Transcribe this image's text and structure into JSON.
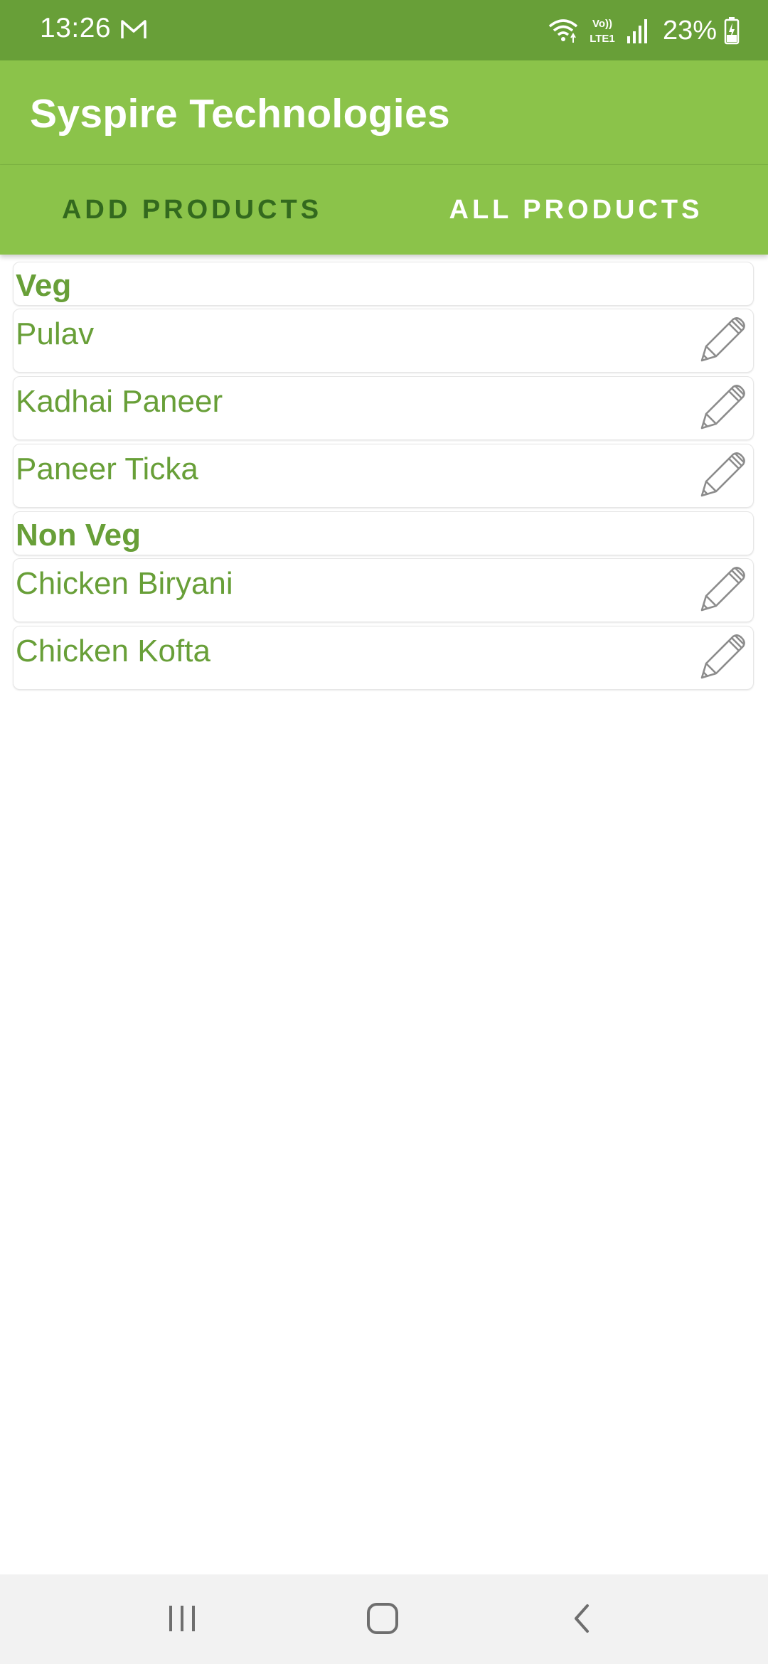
{
  "status_bar": {
    "time": "13:26",
    "battery_percent": "23%",
    "network_label_top": "Vo))",
    "network_label_bottom": "LTE1",
    "icons": [
      "gmail-icon",
      "wifi-icon",
      "volte-icon",
      "signal-icon",
      "battery-charging-icon"
    ]
  },
  "app_bar": {
    "title": "Syspire Technologies"
  },
  "tabs": [
    {
      "label": "ADD PRODUCTS",
      "selected": false
    },
    {
      "label": "ALL PRODUCTS",
      "selected": true
    }
  ],
  "products": {
    "veg_header": "Veg",
    "veg_items": [
      "Pulav",
      "Kadhai Paneer",
      "Paneer Ticka"
    ],
    "nonveg_header": "Non Veg",
    "nonveg_items": [
      "Chicken Biryani",
      "Chicken Kofta"
    ],
    "edit_icon": "pencil-icon"
  },
  "nav_bar": {
    "icons": [
      "recents-icon",
      "home-icon",
      "back-icon"
    ]
  },
  "colors": {
    "status_bar": "#689f38",
    "app_bar": "#8bc34a",
    "text_green": "#689f38",
    "tab_unselected": "#33691e"
  }
}
